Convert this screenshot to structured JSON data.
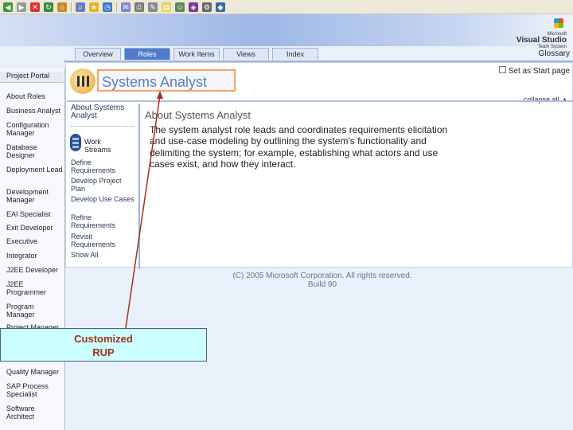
{
  "tabs": [
    "Overview",
    "Roles",
    "Work Items",
    "Views",
    "Index"
  ],
  "glossary": "Glossary",
  "logo": {
    "line1": "Microsoft",
    "line2": "Visual Studio",
    "line3": "Team System"
  },
  "sidebar": {
    "portal": "Project Portal",
    "items": [
      "About Roles",
      "Business Analyst",
      "Configuration Manager",
      "Database Designer",
      "Deployment Lead",
      "Development Manager",
      "EAI Specialist",
      "Exit Developer",
      "Executive",
      "Integrator",
      "J2EE Developer",
      "J2EE Programmer",
      "Program Manager",
      "Project Manager",
      "Quality Manager",
      "SAP Process Specialist",
      "Software Architect"
    ]
  },
  "role": {
    "title": "Systems Analyst",
    "std_page": "Set as Start page",
    "collapse": "collapse all",
    "about_link": "About Systems Analyst",
    "work_streams": "Work Streams",
    "stream_items": [
      "Define Requirements",
      "Develop Project Plan",
      "Develop Use Cases",
      "Refine Requirements",
      "Revisit Requirements",
      "Show All"
    ]
  },
  "content": {
    "title": "About Systems Analyst",
    "text": "The system analyst role leads and coordinates requirements elicitation and use-case modeling by outlining the system's functionality and delimiting the system; for example, establishing what actors and use cases exist, and how they interact."
  },
  "footer": {
    "copyright": "(C) 2005 Microsoft Corporation. All rights reserved.",
    "build": "Build 90"
  },
  "callout": {
    "line1": "Customized",
    "line2": "RUP"
  },
  "colors": {
    "callout_bg": "#ccffff",
    "callout_text": "#a0321e",
    "arrow": "#a0321e",
    "title": "#5a7fc3"
  }
}
